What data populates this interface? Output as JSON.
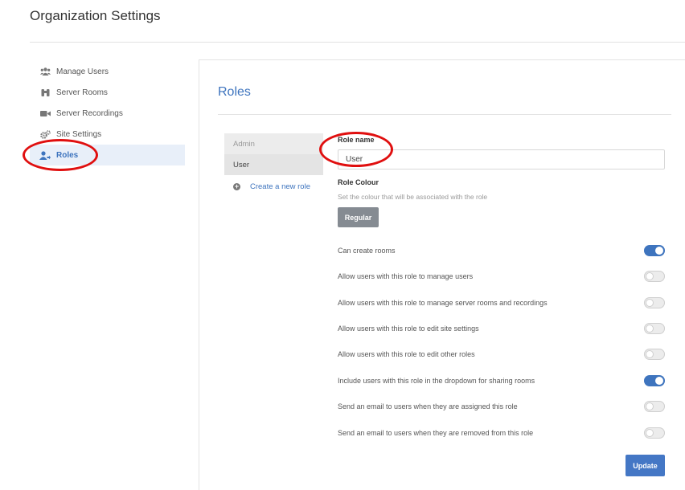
{
  "page": {
    "title": "Organization Settings"
  },
  "sidebar": {
    "items": [
      {
        "label": "Manage Users",
        "icon": "users-icon"
      },
      {
        "label": "Server Rooms",
        "icon": "binoculars-icon"
      },
      {
        "label": "Server Recordings",
        "icon": "video-camera-icon"
      },
      {
        "label": "Site Settings",
        "icon": "cogs-icon"
      },
      {
        "label": "Roles",
        "icon": "user-arrow-icon",
        "active": true
      }
    ]
  },
  "main": {
    "title": "Roles",
    "roles": [
      {
        "label": "Admin"
      },
      {
        "label": "User",
        "selected": true
      }
    ],
    "create_role_label": "Create a new role",
    "form": {
      "role_name_label": "Role name",
      "role_name_value": "User",
      "role_colour_label": "Role Colour",
      "role_colour_hint": "Set the colour that will be associated with the role",
      "colour_button_label": "Regular",
      "permissions": [
        {
          "label": "Can create rooms",
          "enabled": true
        },
        {
          "label": "Allow users with this role to manage users",
          "enabled": false
        },
        {
          "label": "Allow users with this role to manage server rooms and recordings",
          "enabled": false
        },
        {
          "label": "Allow users with this role to edit site settings",
          "enabled": false
        },
        {
          "label": "Allow users with this role to edit other roles",
          "enabled": false
        },
        {
          "label": "Include users with this role in the dropdown for sharing rooms",
          "enabled": true
        },
        {
          "label": "Send an email to users when they are assigned this role",
          "enabled": false
        },
        {
          "label": "Send an email to users when they are removed from this role",
          "enabled": false
        }
      ],
      "update_label": "Update"
    }
  },
  "colors": {
    "accent": "#3e74be",
    "annotation_red": "#e00f0f",
    "toggle_off": "#ececec",
    "colour_button": "#858b92"
  }
}
